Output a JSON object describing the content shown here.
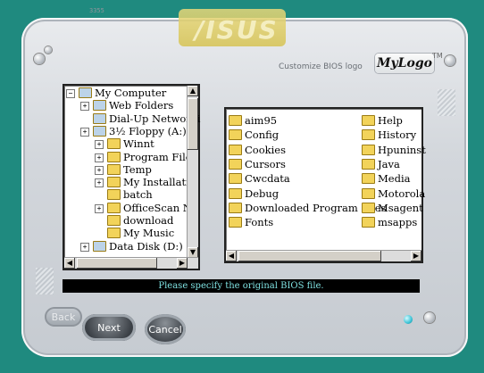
{
  "header": {
    "brand": "/ISUS",
    "tiny_text": "3355",
    "tagline": "Customize BIOS logo",
    "app_name": "MyLogo",
    "trademark": "TM"
  },
  "tree": {
    "items": [
      {
        "label": "My Computer",
        "icon": "computer-icon",
        "indent": 0,
        "expander": "minus"
      },
      {
        "label": "Web Folders",
        "icon": "web-folders-icon",
        "indent": 1,
        "expander": "plus"
      },
      {
        "label": "Dial-Up Networki",
        "icon": "dialup-icon",
        "indent": 1,
        "expander": ""
      },
      {
        "label": "3½ Floppy (A:)",
        "icon": "floppy-icon",
        "indent": 1,
        "expander": "plus"
      },
      {
        "label": "Winnt",
        "icon": "folder-icon",
        "indent": 2,
        "expander": "plus"
      },
      {
        "label": "Program Files",
        "icon": "folder-icon",
        "indent": 2,
        "expander": "plus"
      },
      {
        "label": "Temp",
        "icon": "folder-icon",
        "indent": 2,
        "expander": "plus"
      },
      {
        "label": "My Installatic",
        "icon": "folder-icon",
        "indent": 2,
        "expander": "plus"
      },
      {
        "label": "batch",
        "icon": "folder-icon",
        "indent": 2,
        "expander": ""
      },
      {
        "label": "OfficeScan N",
        "icon": "folder-icon",
        "indent": 2,
        "expander": "plus"
      },
      {
        "label": "download",
        "icon": "folder-icon",
        "indent": 2,
        "expander": ""
      },
      {
        "label": "My Music",
        "icon": "folder-icon",
        "indent": 2,
        "expander": ""
      },
      {
        "label": "Data Disk (D:)",
        "icon": "disk-icon",
        "indent": 1,
        "expander": "plus"
      }
    ]
  },
  "files": {
    "col1": [
      "aim95",
      "Config",
      "Cookies",
      "Cursors",
      "Cwcdata",
      "Debug",
      "Downloaded Program Files",
      "Fonts"
    ],
    "col2": [
      "Help",
      "History",
      "Hpuninst",
      "Java",
      "Media",
      "Motorola",
      "Msagent",
      "msapps"
    ]
  },
  "status": "Please specify the original BIOS file.",
  "buttons": {
    "back": "Back",
    "next": "Next",
    "cancel": "Cancel"
  },
  "colors": {
    "background": "#1f8a7f",
    "status_bg": "#000000",
    "status_text": "#7ee0e0",
    "folder": "#f2d35a"
  }
}
